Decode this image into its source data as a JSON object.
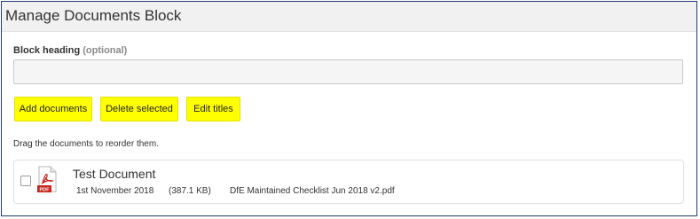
{
  "panel": {
    "title": "Manage Documents Block"
  },
  "form": {
    "heading_label": "Block heading",
    "heading_optional": "(optional)",
    "heading_value": ""
  },
  "toolbar": {
    "add_label": "Add documents",
    "delete_label": "Delete selected",
    "edit_label": "Edit titles"
  },
  "hint": "Drag the documents to reorder them.",
  "documents": [
    {
      "title": "Test Document",
      "date": "1st November 2018",
      "size": "(387.1 KB)",
      "filename": "DfE Maintained Checklist Jun 2018 v2.pdf",
      "icon": "pdf-file-icon",
      "checked": false
    }
  ],
  "colors": {
    "button_bg": "#ffff00",
    "border": "#1f3b73",
    "pdf_red": "#c8241f"
  }
}
